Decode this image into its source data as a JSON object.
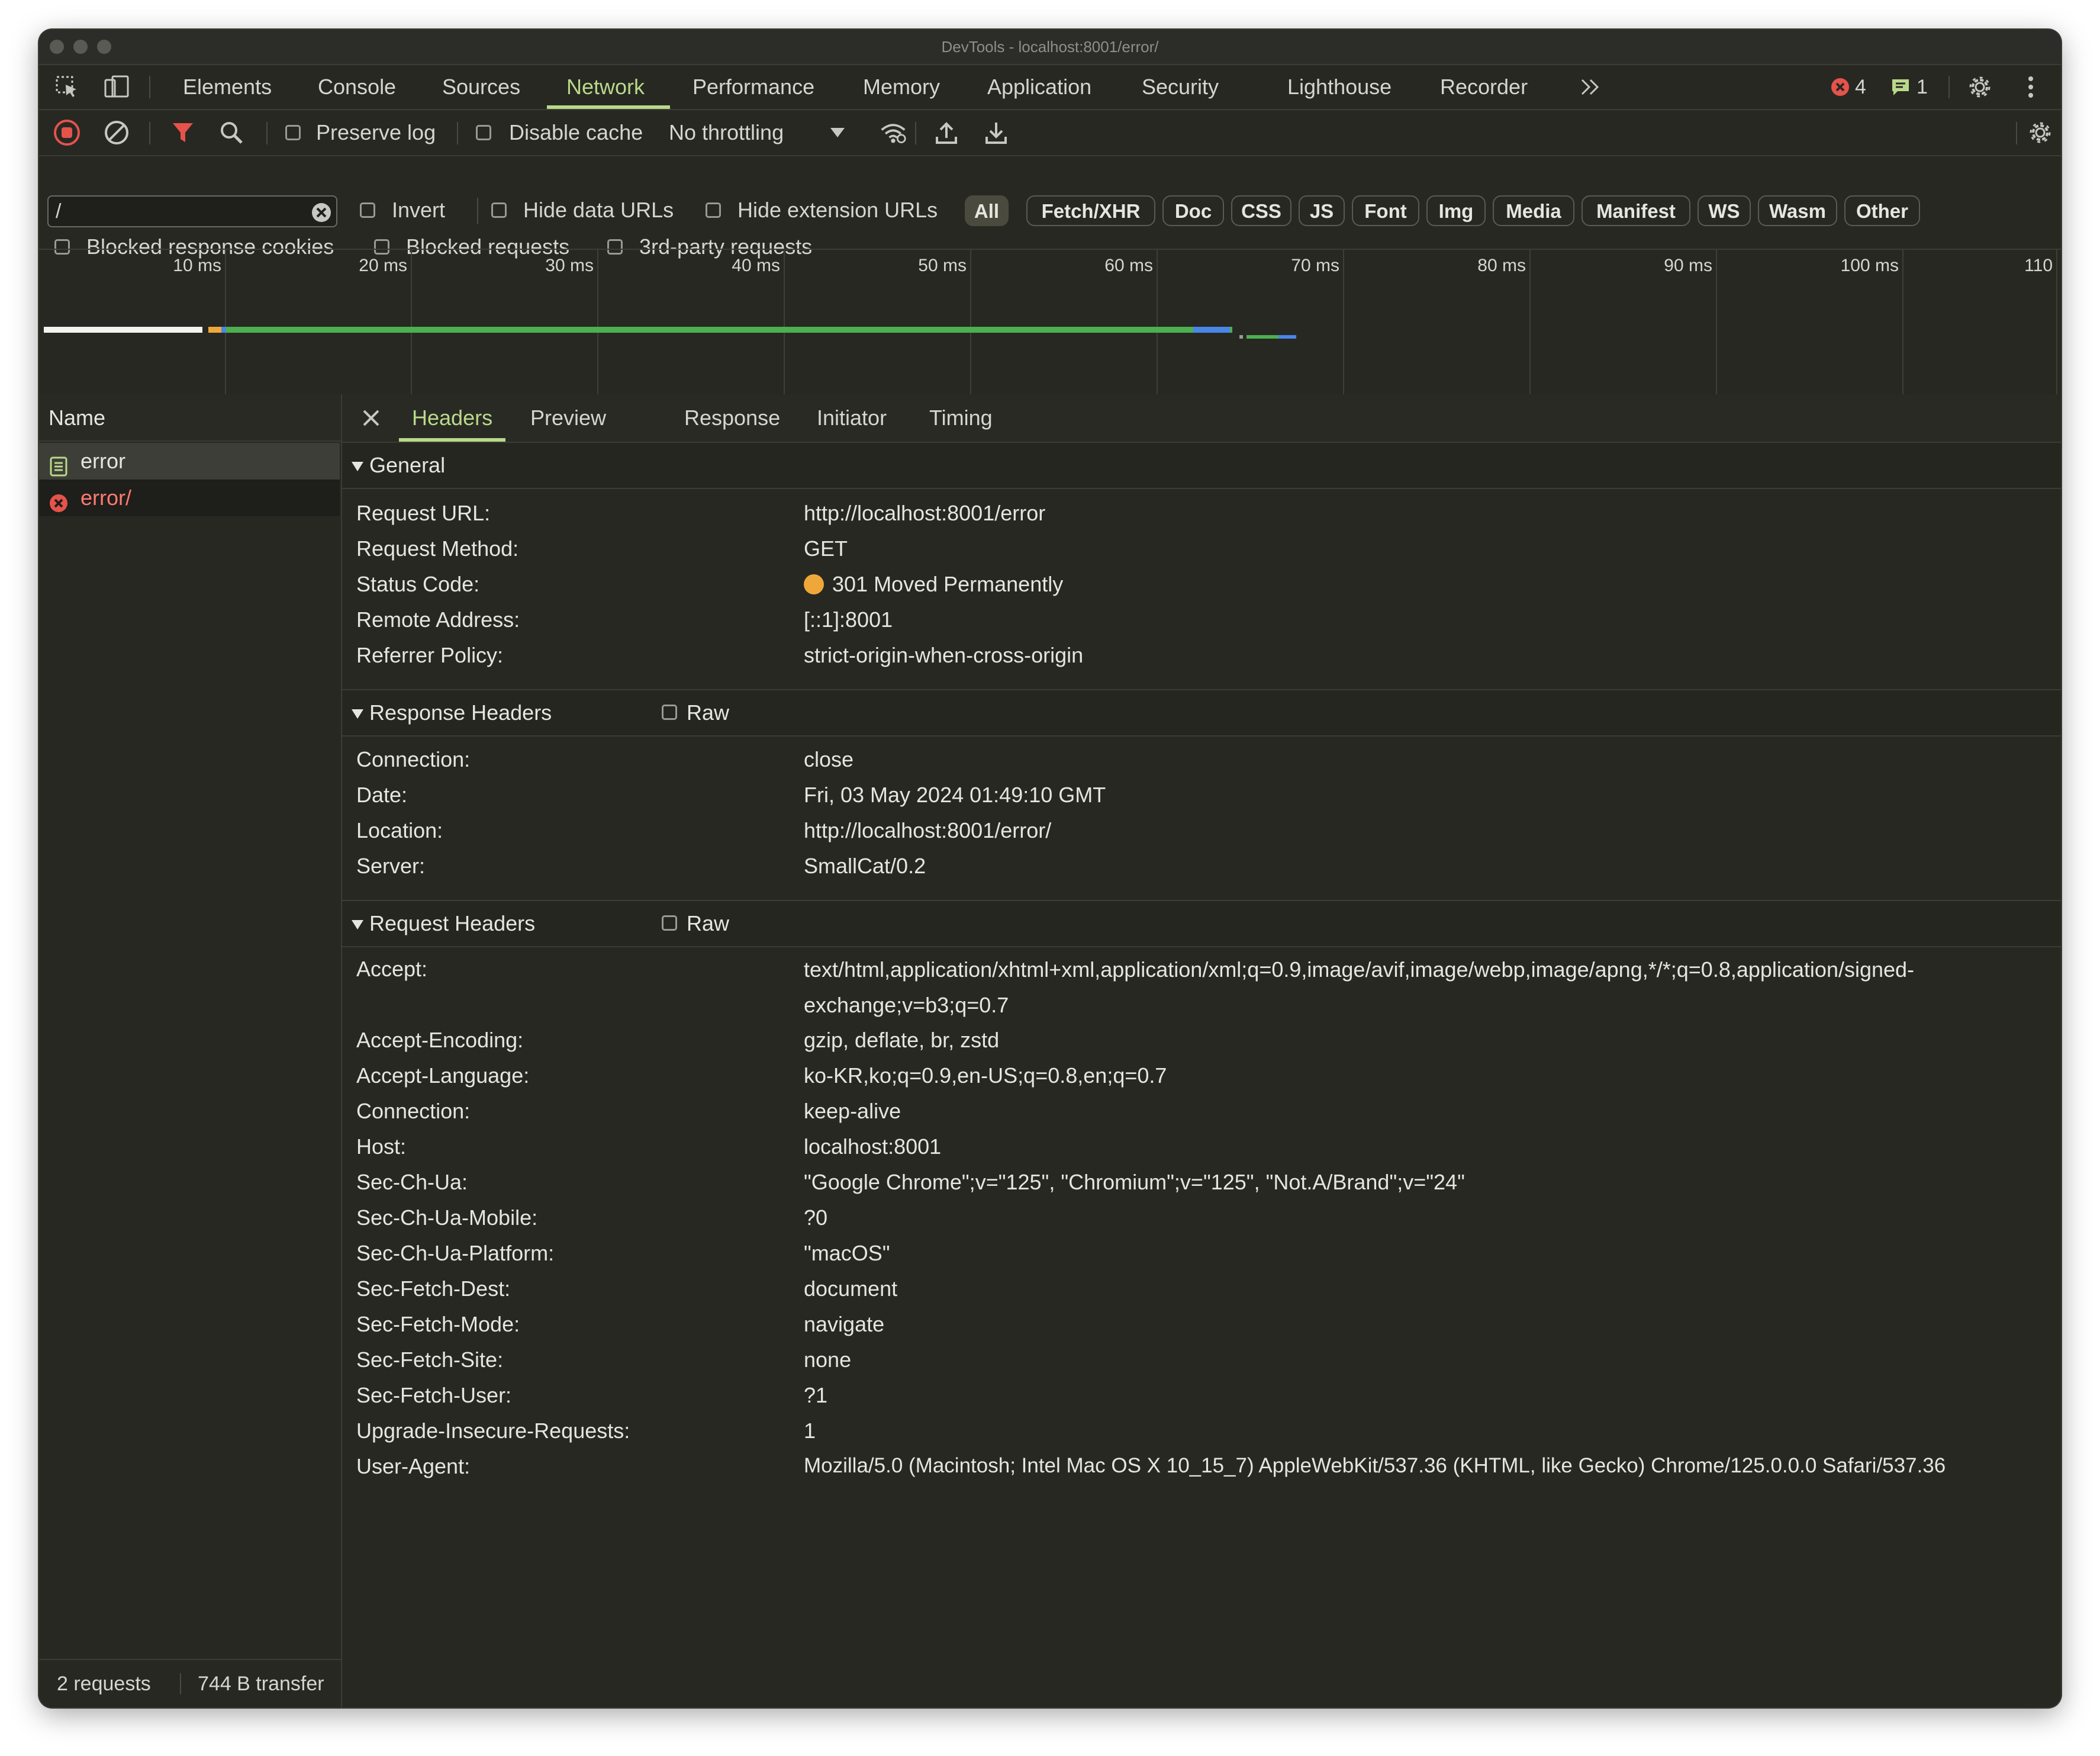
{
  "window": {
    "title": "DevTools - localhost:8001/error/"
  },
  "main_tabs": [
    "Elements",
    "Console",
    "Sources",
    "Network",
    "Performance",
    "Memory",
    "Application",
    "Security",
    "Lighthouse",
    "Recorder"
  ],
  "active_main_tab": "Network",
  "badges": {
    "errors": "4",
    "messages": "1"
  },
  "toolbar": {
    "preserve_log": "Preserve log",
    "disable_cache": "Disable cache",
    "throttling": "No throttling"
  },
  "filter": {
    "value": "/",
    "invert": "Invert",
    "hide_data_urls": "Hide data URLs",
    "hide_extension_urls": "Hide extension URLs",
    "types": [
      "All",
      "Fetch/XHR",
      "Doc",
      "CSS",
      "JS",
      "Font",
      "Img",
      "Media",
      "Manifest",
      "WS",
      "Wasm",
      "Other"
    ],
    "active_type": "All"
  },
  "options_row": {
    "blocked_cookies": "Blocked response cookies",
    "blocked_requests": "Blocked requests",
    "third_party": "3rd-party requests"
  },
  "timeline": {
    "ticks": [
      "10 ms",
      "20 ms",
      "30 ms",
      "40 ms",
      "50 ms",
      "60 ms",
      "70 ms",
      "80 ms",
      "90 ms",
      "100 ms",
      "110"
    ]
  },
  "request_list": {
    "header": "Name",
    "rows": [
      {
        "name": "error",
        "icon": "document-icon",
        "selected": true
      },
      {
        "name": "error/",
        "icon": "error-icon",
        "selected": false
      }
    ]
  },
  "status_bar": {
    "requests": "2 requests",
    "transferred": "744 B transfer"
  },
  "detail_tabs": [
    "Headers",
    "Preview",
    "Response",
    "Initiator",
    "Timing"
  ],
  "active_detail_tab": "Headers",
  "sections": {
    "general": {
      "title": "General",
      "rows": [
        {
          "key": "Request URL:",
          "value": "http://localhost:8001/error"
        },
        {
          "key": "Request Method:",
          "value": "GET"
        },
        {
          "key": "Status Code:",
          "value": "301 Moved Permanently"
        },
        {
          "key": "Remote Address:",
          "value": "[::1]:8001"
        },
        {
          "key": "Referrer Policy:",
          "value": "strict-origin-when-cross-origin"
        }
      ]
    },
    "response_headers": {
      "title": "Response Headers",
      "raw": "Raw",
      "rows": [
        {
          "key": "Connection:",
          "value": "close"
        },
        {
          "key": "Date:",
          "value": "Fri, 03 May 2024 01:49:10 GMT"
        },
        {
          "key": "Location:",
          "value": "http://localhost:8001/error/"
        },
        {
          "key": "Server:",
          "value": "SmallCat/0.2"
        }
      ]
    },
    "request_headers": {
      "title": "Request Headers",
      "raw": "Raw",
      "rows": [
        {
          "key": "Accept:",
          "value": "text/html,application/xhtml+xml,application/xml;q=0.9,image/avif,image/webp,image/apng,*/*;q=0.8,application/signed-exchange;v=b3;q=0.7"
        },
        {
          "key": "Accept-Encoding:",
          "value": "gzip, deflate, br, zstd"
        },
        {
          "key": "Accept-Language:",
          "value": "ko-KR,ko;q=0.9,en-US;q=0.8,en;q=0.7"
        },
        {
          "key": "Connection:",
          "value": "keep-alive"
        },
        {
          "key": "Host:",
          "value": "localhost:8001"
        },
        {
          "key": "Sec-Ch-Ua:",
          "value": "\"Google Chrome\";v=\"125\", \"Chromium\";v=\"125\", \"Not.A/Brand\";v=\"24\""
        },
        {
          "key": "Sec-Ch-Ua-Mobile:",
          "value": "?0"
        },
        {
          "key": "Sec-Ch-Ua-Platform:",
          "value": "\"macOS\""
        },
        {
          "key": "Sec-Fetch-Dest:",
          "value": "document"
        },
        {
          "key": "Sec-Fetch-Mode:",
          "value": "navigate"
        },
        {
          "key": "Sec-Fetch-Site:",
          "value": "none"
        },
        {
          "key": "Sec-Fetch-User:",
          "value": "?1"
        },
        {
          "key": "Upgrade-Insecure-Requests:",
          "value": "1"
        },
        {
          "key": "User-Agent:",
          "value": "Mozilla/5.0 (Macintosh; Intel Mac OS X 10_15_7) AppleWebKit/537.36 (KHTML, like Gecko) Chrome/125.0.0.0 Safari/537.36"
        }
      ]
    }
  },
  "colors": {
    "accent": "#b9d98a",
    "error": "#e5534b",
    "status_redirect": "#f0a73a",
    "background": "#282823"
  }
}
